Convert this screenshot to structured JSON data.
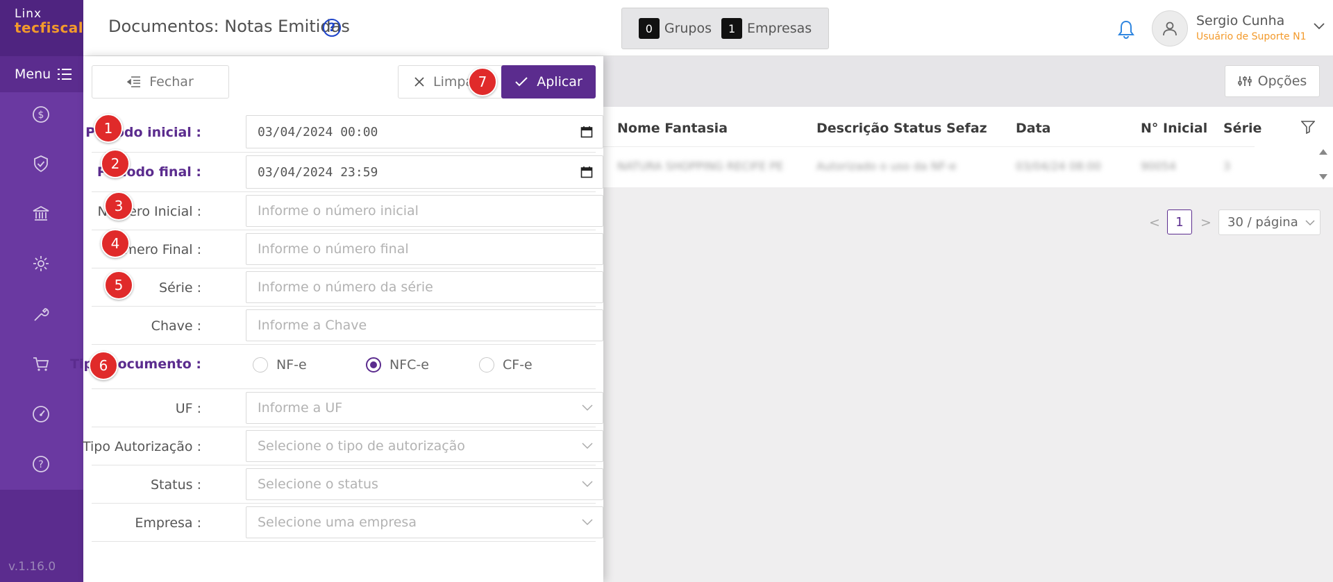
{
  "sidebar": {
    "logo_top": "Linx",
    "logo_bottom": "tecfiscal",
    "menu_label": "Menu",
    "version": "v.1.16.0"
  },
  "header": {
    "title": "Documentos: Notas Emitidas",
    "help_glyph": "?",
    "groups_count": "0",
    "groups_label": "Grupos",
    "companies_count": "1",
    "companies_label": "Empresas",
    "user_name": "Sergio Cunha",
    "user_role": "Usuário de Suporte N1"
  },
  "panel": {
    "close_label": "Fechar",
    "clear_label": "Limpar",
    "apply_label": "Aplicar",
    "fields": {
      "periodo_inicial": {
        "label": "Período inicial :",
        "value": "03/04/2024 00:00"
      },
      "periodo_final": {
        "label": "Período final :",
        "value": "03/04/2024 23:59"
      },
      "numero_inicial": {
        "label": "Número Inicial :",
        "placeholder": "Informe o número inicial"
      },
      "numero_final": {
        "label": "Número Final :",
        "placeholder": "Informe o número final"
      },
      "serie": {
        "label": "Série :",
        "placeholder": "Informe o número da série"
      },
      "chave": {
        "label": "Chave :",
        "placeholder": "Informe a Chave"
      },
      "tipo_documento": {
        "label": "Tipo Documento :",
        "options": [
          "NF-e",
          "NFC-e",
          "CF-e"
        ],
        "selected": "NFC-e"
      },
      "uf": {
        "label": "UF :",
        "placeholder": "Informe a UF"
      },
      "tipo_autorizacao": {
        "label": "Tipo Autorização :",
        "placeholder": "Selecione o tipo de autorização"
      },
      "status": {
        "label": "Status :",
        "placeholder": "Selecione o status"
      },
      "empresa": {
        "label": "Empresa :",
        "placeholder": "Selecione uma empresa"
      }
    }
  },
  "annotations": [
    "1",
    "2",
    "3",
    "4",
    "5",
    "6",
    "7"
  ],
  "content": {
    "options_label": "Opções",
    "columns": [
      "Nome Fantasia",
      "Descrição Status Sefaz",
      "Data",
      "N° Inicial",
      "Série"
    ],
    "row": [
      "NATURA SHOPPING RECIFE PE",
      "Autorizado o uso da NF-e",
      "03/04/24 08:00",
      "90054",
      "3"
    ],
    "pagination": {
      "current": "1",
      "page_size": "30 / página"
    }
  },
  "colors": {
    "brand": "#5b2c8e",
    "accent": "#f39a2b",
    "badge": "#e02a2a",
    "link_blue": "#1e44c9"
  }
}
